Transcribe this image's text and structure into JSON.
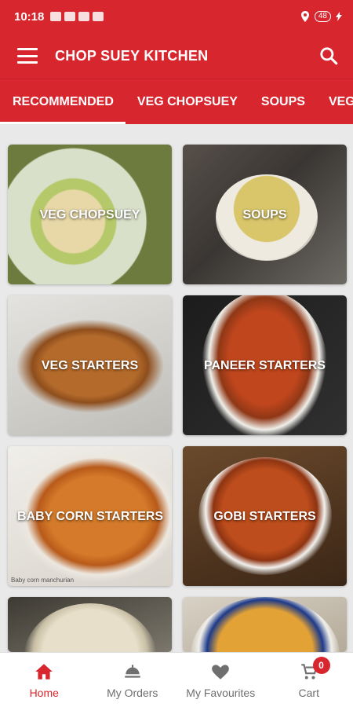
{
  "status_bar": {
    "time": "10:18",
    "battery": "48"
  },
  "app_bar": {
    "title": "CHOP SUEY KITCHEN",
    "menu_icon": "hamburger-menu-icon",
    "search_icon": "search-icon"
  },
  "tabs": [
    {
      "label": "RECOMMENDED",
      "active": true
    },
    {
      "label": "VEG CHOPSUEY",
      "active": false
    },
    {
      "label": "SOUPS",
      "active": false
    },
    {
      "label": "VEG",
      "active": false
    }
  ],
  "categories": [
    {
      "label": "VEG CHOPSUEY"
    },
    {
      "label": "SOUPS"
    },
    {
      "label": "VEG STARTERS"
    },
    {
      "label": "PANEER STARTERS"
    },
    {
      "label": "BABY CORN STARTERS",
      "caption": "Baby corn manchurian"
    },
    {
      "label": "GOBI STARTERS"
    },
    {
      "label": ""
    },
    {
      "label": ""
    }
  ],
  "bottom_nav": [
    {
      "label": "Home",
      "icon": "home-icon",
      "active": true
    },
    {
      "label": "My Orders",
      "icon": "orders-icon",
      "active": false
    },
    {
      "label": "My Favourites",
      "icon": "heart-icon",
      "active": false
    },
    {
      "label": "Cart",
      "icon": "cart-icon",
      "active": false,
      "badge": "0"
    }
  ],
  "colors": {
    "primary": "#d8262f",
    "inactive_nav": "#6f6f6f"
  }
}
